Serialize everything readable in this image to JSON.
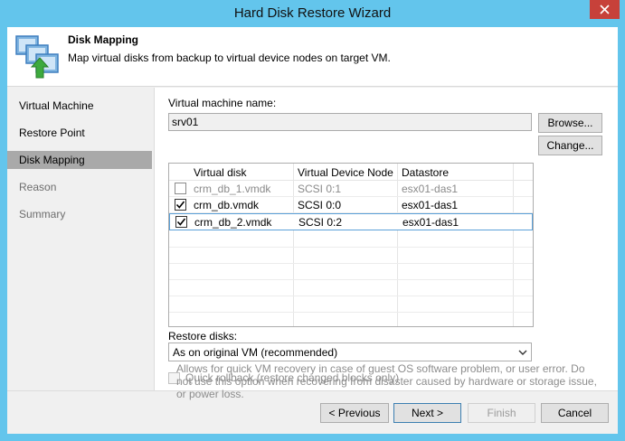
{
  "window": {
    "title": "Hard Disk Restore Wizard"
  },
  "header": {
    "title": "Disk Mapping",
    "description": "Map virtual disks from backup to virtual device nodes on target VM."
  },
  "steps": [
    {
      "label": "Virtual Machine",
      "state": "normal"
    },
    {
      "label": "Restore Point",
      "state": "normal"
    },
    {
      "label": "Disk Mapping",
      "state": "active"
    },
    {
      "label": "Reason",
      "state": "disabled"
    },
    {
      "label": "Summary",
      "state": "disabled"
    }
  ],
  "vm_name": {
    "label": "Virtual machine name:",
    "value": "srv01"
  },
  "buttons": {
    "browse": "Browse...",
    "change": "Change...",
    "previous": "< Previous",
    "next": "Next >",
    "finish": "Finish",
    "cancel": "Cancel"
  },
  "disk_table": {
    "columns": [
      "Virtual disk",
      "Virtual Device Node",
      "Datastore"
    ],
    "rows": [
      {
        "checked": false,
        "disk": "crm_db_1.vmdk",
        "node": "SCSI 0:1",
        "datastore": "esx01-das1",
        "muted": true,
        "selected": false
      },
      {
        "checked": true,
        "disk": "crm_db.vmdk",
        "node": "SCSI 0:0",
        "datastore": "esx01-das1",
        "muted": false,
        "selected": false
      },
      {
        "checked": true,
        "disk": "crm_db_2.vmdk",
        "node": "SCSI 0:2",
        "datastore": "esx01-das1",
        "muted": false,
        "selected": true
      }
    ]
  },
  "restore_disks": {
    "label": "Restore disks:",
    "selected": "As on original VM (recommended)"
  },
  "quick_rollback": {
    "label": "Quick rollback (restore changed blocks only)",
    "description": "Allows for quick VM recovery in case of guest OS software problem, or user error. Do not use this option when recovering from disaster caused by hardware or storage issue, or power loss.",
    "checked": false,
    "enabled": false
  },
  "colors": {
    "titlebar": "#63c5ec",
    "close": "#c7413a",
    "step_active": "#a9a9a9",
    "selection_border": "#5ba0d8"
  }
}
